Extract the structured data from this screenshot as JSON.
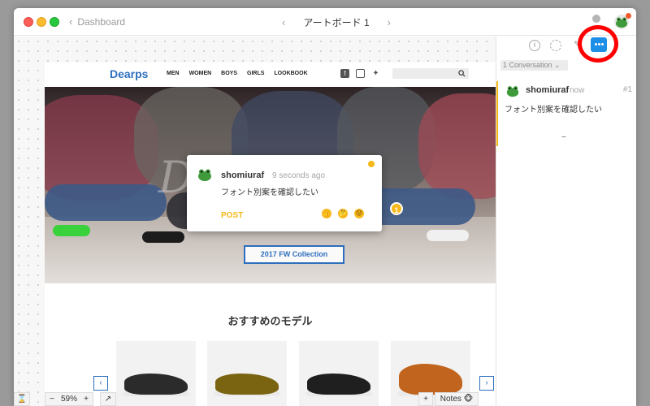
{
  "titlebar": {
    "back_label": "Dashboard",
    "back_chevron": "‹",
    "artboard_name": "アートボード 1",
    "prev_arrow": "‹",
    "next_arrow": "›"
  },
  "site": {
    "brand": "Dearps",
    "nav": [
      "MEN",
      "WOMEN",
      "BOYS",
      "GIRLS",
      "LOOKBOOK"
    ],
    "social_icons": [
      "facebook-icon",
      "instagram-icon",
      "twitter-icon"
    ],
    "search_icon": "search-icon",
    "collection_button": "2017 FW Collection",
    "section_title": "おすすめのモデル",
    "prev_arrow": "‹",
    "next_arrow": "›"
  },
  "popup": {
    "user": "shomiuraf",
    "time": "9 seconds ago",
    "text": "フォント別案を確認したい",
    "post_label": "POST",
    "reactions": [
      "👍",
      "🤔",
      "😟"
    ],
    "marker_number": "1"
  },
  "bottom": {
    "hourglass": "⌛",
    "zoom_minus": "−",
    "zoom_value": "59%",
    "zoom_plus": "+",
    "export_icon": "↗",
    "add_label": "+",
    "notes_label": "Notes 🐵"
  },
  "panel": {
    "conversation_select": "1 Conversation ⌄",
    "entry": {
      "user": "shomiuraf",
      "time": "now",
      "number": "#1",
      "text": "フォント別案を確認したい"
    },
    "tilde": "~"
  },
  "colors": {
    "accent_yellow": "#f5b91a",
    "brand_blue": "#2d6fbe",
    "chat_blue": "#1e8fe6",
    "highlight_red": "#ff0000"
  }
}
